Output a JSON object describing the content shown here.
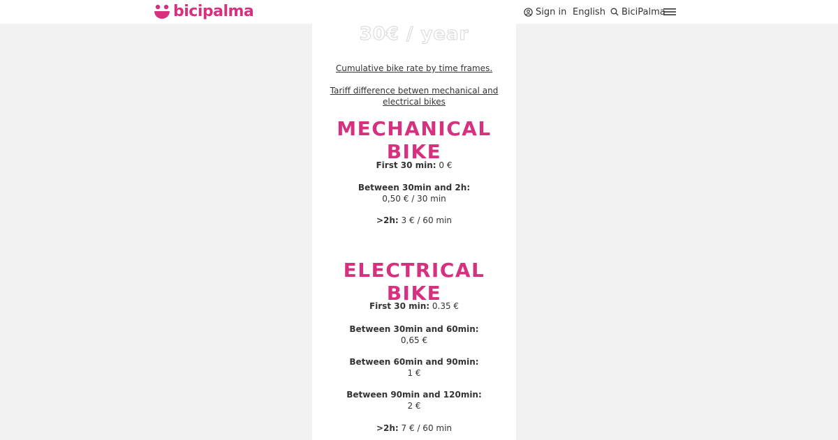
{
  "header": {
    "logo_text": "bicipalma",
    "nav": {
      "sign_in": "Sign in",
      "language": "English",
      "search_label": "BiciPalma"
    },
    "brand_color": "#d6317f"
  },
  "card": {
    "price_heading": "30€ / year",
    "link_cumulative": "Cumulative bike rate by time frames.",
    "link_tariff": "Tariff difference betwen mechanical and electrical bikes",
    "mechanical": {
      "title": "MECHANICAL BIKE",
      "rates": [
        {
          "label": "First 30 min:",
          "value": "0 €"
        },
        {
          "label": "Between 30min and 2h:",
          "value": "0,50 € / 30 min"
        },
        {
          "label": ">2h:",
          "value": "3 € / 60 min"
        }
      ]
    },
    "electrical": {
      "title": "ELECTRICAL BIKE",
      "rates": [
        {
          "label": "First 30 min:",
          "value": "0.35 €"
        },
        {
          "label": "Between 30min and 60min:",
          "value": "0,65 €"
        },
        {
          "label": "Between 60min and 90min:",
          "value": "1 €"
        },
        {
          "label": "Between 90min and 120min:",
          "value": "2 €"
        },
        {
          "label": ">2h:",
          "value": "7 € / 60 min"
        }
      ]
    }
  }
}
